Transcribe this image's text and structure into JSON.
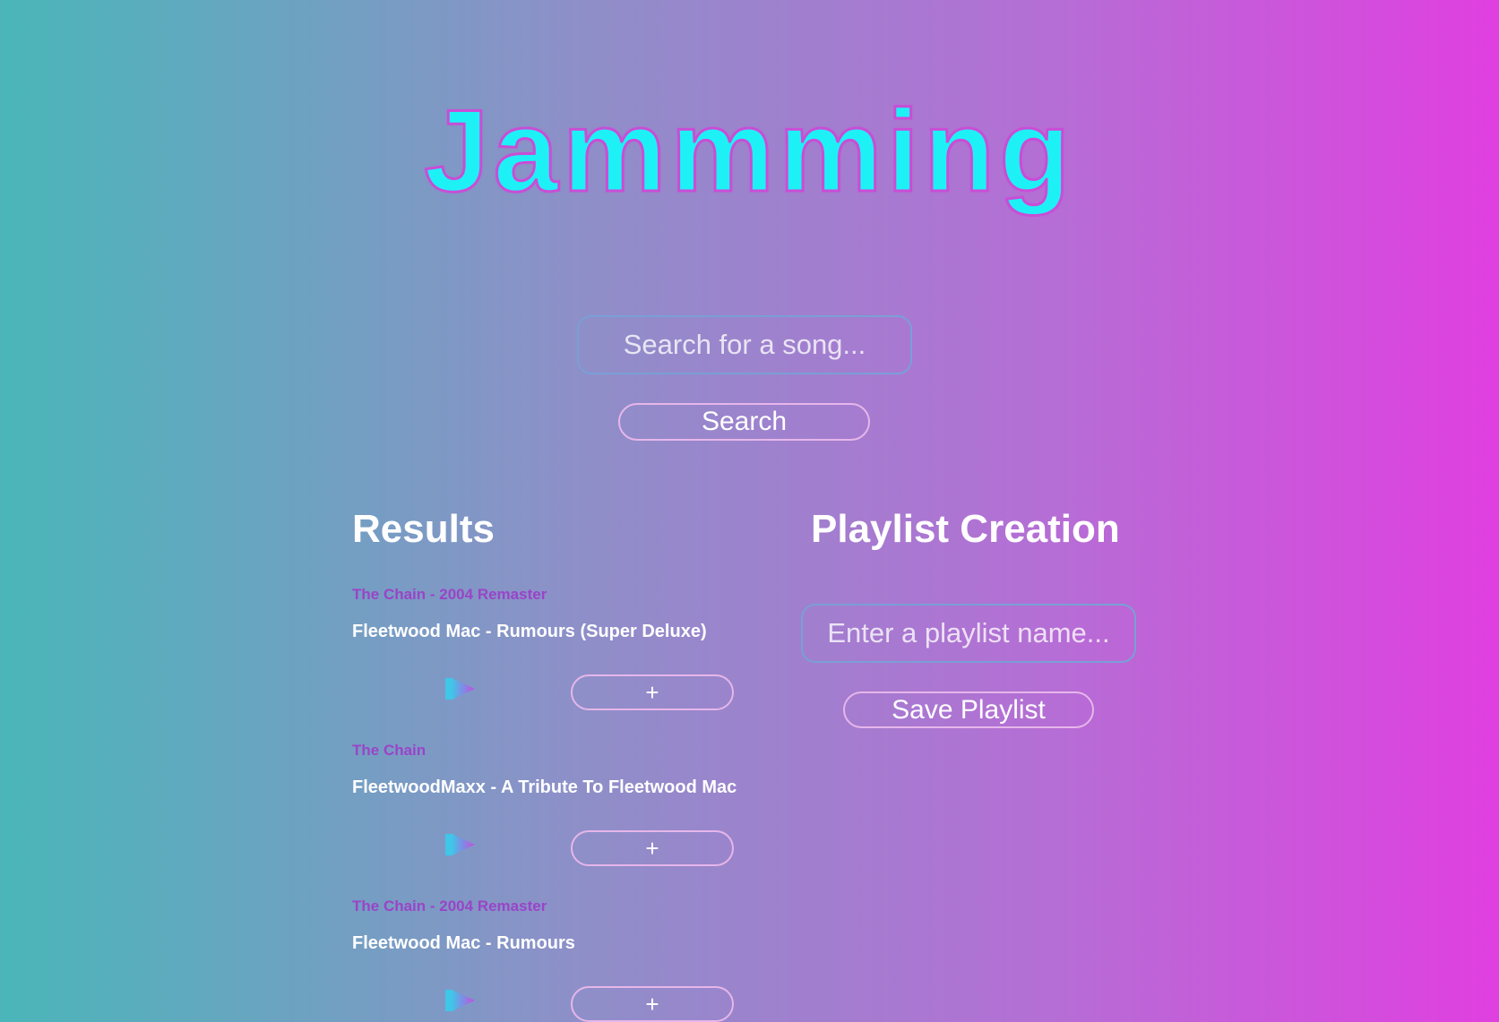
{
  "app": {
    "title": "Jammming"
  },
  "search": {
    "placeholder": "Search for a song...",
    "button_label": "Search"
  },
  "results": {
    "heading": "Results",
    "tracks": [
      {
        "name": "The Chain - 2004 Remaster",
        "artist_album": "Fleetwood Mac - Rumours (Super Deluxe)",
        "add_label": "+"
      },
      {
        "name": "The Chain",
        "artist_album": "FleetwoodMaxx - A Tribute To Fleetwood Mac",
        "add_label": "+"
      },
      {
        "name": "The Chain - 2004 Remaster",
        "artist_album": "Fleetwood Mac - Rumours",
        "add_label": "+"
      }
    ]
  },
  "playlist": {
    "heading": "Playlist Creation",
    "name_placeholder": "Enter a playlist name...",
    "save_label": "Save Playlist"
  },
  "colors": {
    "gradient_start": "#4ab6b9",
    "gradient_end": "#e03fe0",
    "title_fill": "#1ef1f6",
    "title_stroke": "#c94dd6",
    "track_name": "#9a44c8"
  },
  "icons": {
    "play": "play-icon"
  }
}
